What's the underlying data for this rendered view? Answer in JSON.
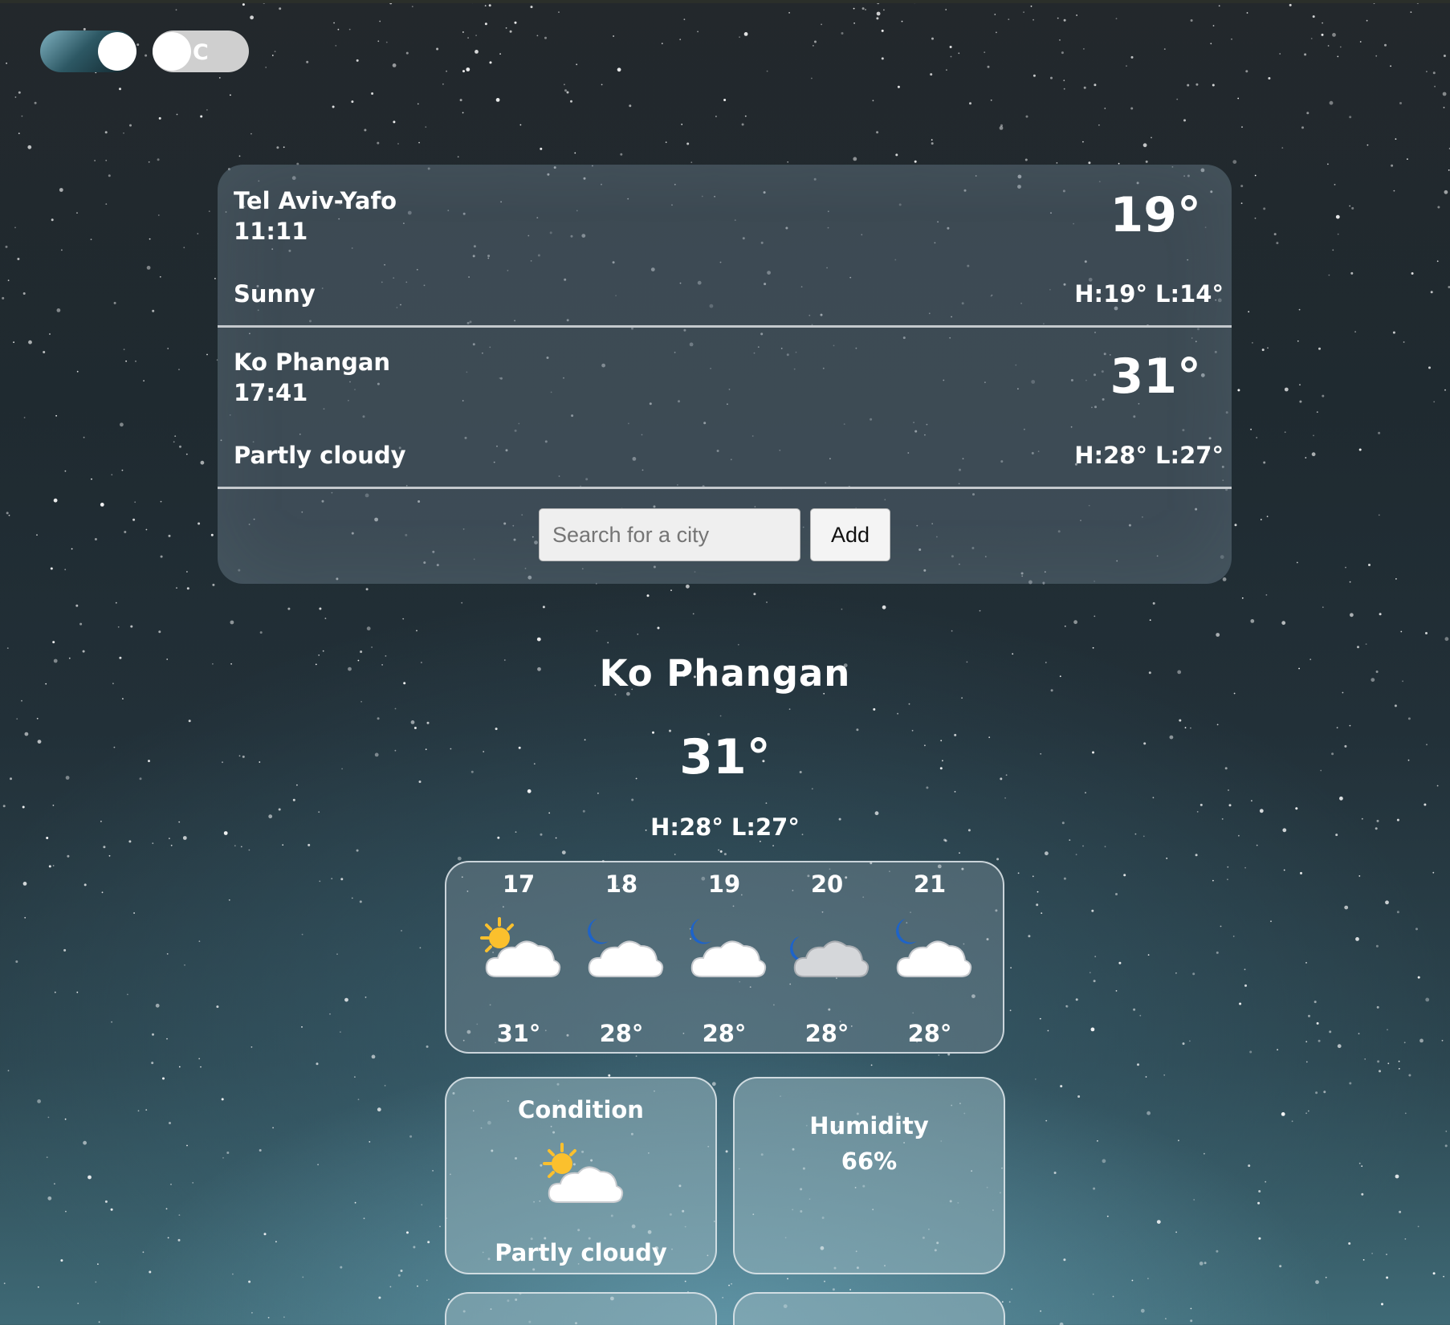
{
  "toggles": {
    "theme": {
      "icon": "night-sky-thumbnail",
      "state": "on"
    },
    "unit": {
      "label": "C",
      "state": "off"
    }
  },
  "cities": [
    {
      "name": "Tel Aviv-Yafo",
      "time": "11:11",
      "condition": "Sunny",
      "temp": "19°",
      "hl": "H:19° L:14°"
    },
    {
      "name": "Ko Phangan",
      "time": "17:41",
      "condition": "Partly cloudy",
      "temp": "31°",
      "hl": "H:28° L:27°"
    }
  ],
  "search": {
    "placeholder": "Search for a city",
    "value": "",
    "add_label": "Add"
  },
  "current": {
    "city": "Ko Phangan",
    "temp": "31°",
    "hl": "H:28° L:27°"
  },
  "forecast": [
    {
      "day": "17",
      "icon": "sun-behind-cloud-icon",
      "temp": "31°"
    },
    {
      "day": "18",
      "icon": "moon-cloud-icon",
      "temp": "28°"
    },
    {
      "day": "19",
      "icon": "moon-cloud-icon",
      "temp": "28°"
    },
    {
      "day": "20",
      "icon": "moon-dark-cloud-icon",
      "temp": "28°"
    },
    {
      "day": "21",
      "icon": "moon-cloud-icon",
      "temp": "28°"
    }
  ],
  "details": {
    "condition": {
      "title": "Condition",
      "icon": "sun-behind-cloud-icon",
      "value": "Partly cloudy"
    },
    "humidity": {
      "title": "Humidity",
      "value": "66%"
    }
  },
  "colors": {
    "sun": "#fbc02d",
    "moon": "#1e63c9",
    "cloud": "#ffffff",
    "dark_cloud": "#d5d7da",
    "panel": "#566672"
  }
}
